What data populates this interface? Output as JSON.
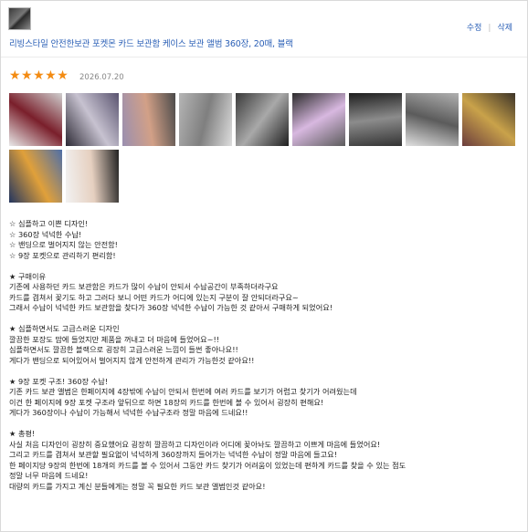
{
  "product": {
    "name": "리빙스타일 안전한보관 포켓몬 카드 보관함 케이스 보관 앨범 360장, 20매, 블랙"
  },
  "actions": {
    "edit": "수정",
    "separator": "|",
    "delete": "삭제"
  },
  "rating": {
    "stars": 5,
    "max": 5,
    "glyphs": "★★★★★"
  },
  "date": "2026.07.20",
  "photos": [
    {
      "name": "photo-1",
      "colors": [
        "#e9e9e9",
        "#7a1f2b",
        "#cfcfcf"
      ]
    },
    {
      "name": "photo-2",
      "colors": [
        "#2d2a35",
        "#c7c2d0",
        "#5a5470"
      ]
    },
    {
      "name": "photo-3",
      "colors": [
        "#9a8fb0",
        "#d2a087",
        "#4a4a4a"
      ]
    },
    {
      "name": "photo-4",
      "colors": [
        "#b5b5b5",
        "#7f7f7f",
        "#dedede"
      ]
    },
    {
      "name": "photo-5",
      "colors": [
        "#3a3a3a",
        "#a9a9a9",
        "#1f1f1f"
      ]
    },
    {
      "name": "photo-6",
      "colors": [
        "#2b2b2b",
        "#d8b8e0",
        "#5c5c5c"
      ]
    },
    {
      "name": "photo-7",
      "colors": [
        "#1e1e1e",
        "#8c8c8c",
        "#333333"
      ]
    },
    {
      "name": "photo-8",
      "colors": [
        "#b0b0b0",
        "#5b5b5b",
        "#e0e0e0"
      ]
    },
    {
      "name": "photo-9",
      "colors": [
        "#3d3428",
        "#c9a24a",
        "#6b3d3d"
      ]
    },
    {
      "name": "photo-10",
      "colors": [
        "#4e6fa8",
        "#e0a03a",
        "#23355f"
      ]
    },
    {
      "name": "photo-11",
      "colors": [
        "#222222",
        "#e6d0c0",
        "#f2f2f2"
      ]
    }
  ],
  "review_lines": [
    "☆ 심플하고 이쁜 디자인!",
    "☆ 360장 넉넉한 수납!",
    "☆ 밴딩으로 벌어지지 않는 안전함!",
    "☆ 9장 포켓으로 관리하기 편리함!",
    "",
    "★ 구매이유",
    "기존에 사용하던 카드 보관함은 카드가 많이 수납이 안되서 수납공간이 부족하더라구요",
    "카드를 겹쳐서 꽂기도 하고 그러다 보니 어떤 카드가 어디에 있는지 구분이 잘 안되더라구요~",
    "그래서 수납이 넉넉한 카드 보관함을 찾다가 360장 넉넉한 수납이 가능한 것 같아서 구매하게 되었어요!",
    "",
    "★ 심플하면서도 고급스러운 디자인",
    "깔끔한 포장도 맘에 들었지만 제품을 꺼내고 더 마음에 들었어요~!!",
    "심플하면서도 깔끔한 블랙으로 굉장히 고급스러운 느낌이 들썬 좋아나요!!",
    "게다가 밴딩으로 되어있어서 벌어지지 않게 안전하게 관리가 가능한것 같아요!!",
    "",
    "★ 9장 포켓 구조! 360장 수납!",
    "기존 카드 보관 앨범은 한페이지에 4장밖에 수납이 안되서 한번에 여러 카드를 보기가 어렵고 찾기가 어려웠는데",
    "이건 한 페이지에 9장 포켓 구조라 앞뒤으로 하면 18장의 카드를 한번에 볼 수 있어서 굉장히 편해요!",
    "게다가 360장이나 수납이 가능해서 넉넉한 수납구조라 정말 마음에 드네요!!",
    "",
    "★ 총평!",
    "사실 처음 디자인이 굉장히 중요했어요 굉장히 깔끔하고 디자인이라 어디에 꽂아놔도 깔끔하고 이쁘게 마음에 들었어요!",
    "그리고 카드를 겹쳐서 보관할 필요없이 넉넉하게 360장까지 들어가는 넉넉한 수납이 정말 마음에 들고요!",
    "한 페이지당 9장의 한번에 18개의 카드를 볼 수 있어서 그동안 카드 찾기가 어려움이 있었는데 편하게 카드를 찾을 수 있는 점도",
    "정말 너무 마음에 드네요!",
    "대량의 카드를 가지고 계신 분들에게는 정말 꼭 필요한 카드 보관 앨범인것 같아요!"
  ]
}
